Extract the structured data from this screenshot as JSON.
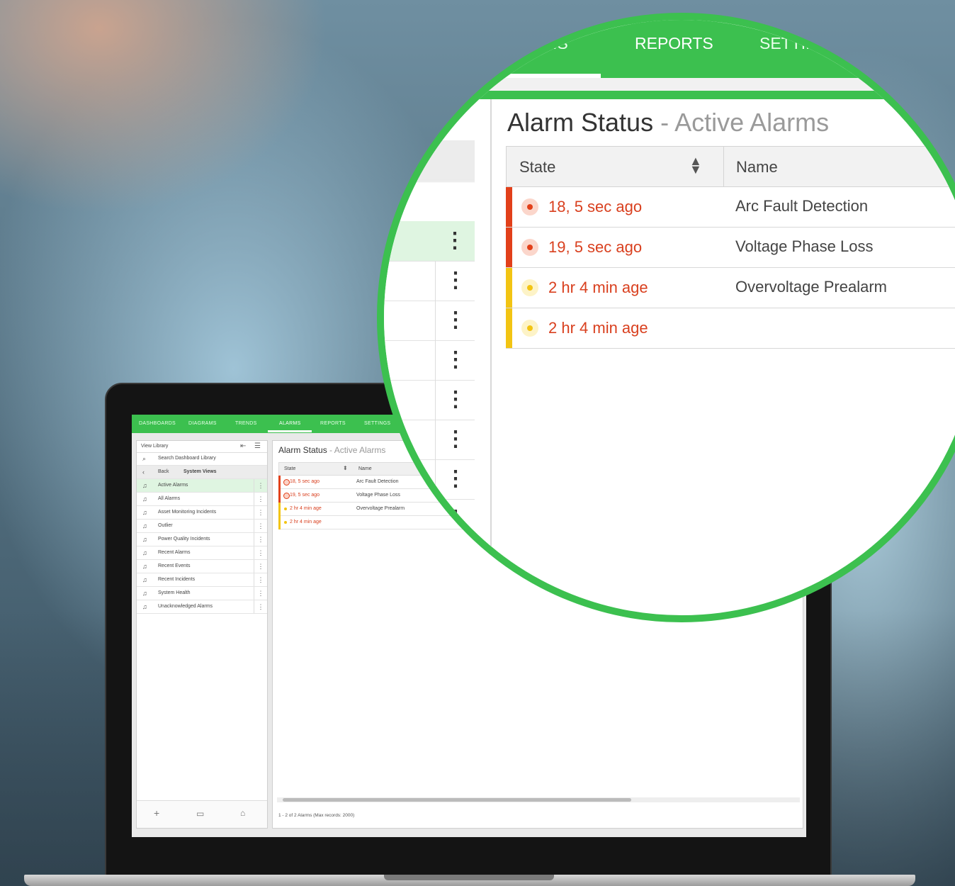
{
  "colors": {
    "accent_green": "#3cc04f",
    "alarm_red": "#e2401a",
    "alarm_yellow": "#f2c413",
    "state_text_red": "#d9401f"
  },
  "nav": {
    "tabs": [
      {
        "label": "DASHBOARDS"
      },
      {
        "label": "DIAGRAMS"
      },
      {
        "label": "TRENDS"
      },
      {
        "label": "ALARMS"
      },
      {
        "label": "REPORTS"
      },
      {
        "label": "SETTINGS"
      }
    ],
    "active_tab": "ALARMS"
  },
  "zoom_nav": {
    "tab_partial_left": "IS",
    "tab_reports": "REPORTS",
    "tab_settings_partial": "SETTIN"
  },
  "library": {
    "title": "View Library",
    "search_placeholder": "Search Dashboard Library",
    "back_label": "Back",
    "folder_label": "System Views",
    "items": [
      {
        "label": "Active Alarms",
        "icon": "bell-icon",
        "active": true
      },
      {
        "label": "All Alarms",
        "icon": "bell-icon"
      },
      {
        "label": "Asset Monitoring Incidents",
        "icon": "bell-icon"
      },
      {
        "label": "Outlier",
        "icon": "bell-icon"
      },
      {
        "label": "Power Quality Incidents",
        "icon": "bell-icon"
      },
      {
        "label": "Recent Alarms",
        "icon": "bell-icon"
      },
      {
        "label": "Recent Events",
        "icon": "bell-icon"
      },
      {
        "label": "Recent Incidents",
        "icon": "bell-icon"
      },
      {
        "label": "System Health",
        "icon": "bell-icon"
      },
      {
        "label": "Unacknowledged Alarms",
        "icon": "bell-icon"
      }
    ],
    "footer_icons": [
      "plus-icon",
      "folder-icon",
      "home-icon"
    ]
  },
  "alarm_view": {
    "title": "Alarm Status",
    "title_separator": " - ",
    "subtitle": "Active Alarms",
    "columns": [
      "State",
      "Name"
    ],
    "rows": [
      {
        "state": "18, 5 sec ago",
        "name": "Arc Fault Detection",
        "severity": "red"
      },
      {
        "state": "19, 5 sec ago",
        "name": "Voltage Phase Loss",
        "severity": "red"
      },
      {
        "state": "2 hr 4 min age",
        "name": "Overvoltage Prealarm",
        "severity": "yellow"
      },
      {
        "state": "2 hr 4 min age",
        "name": "",
        "severity": "yellow"
      }
    ],
    "footer": "1 - 2 of 2 Alarms (Max records: 2000)"
  }
}
